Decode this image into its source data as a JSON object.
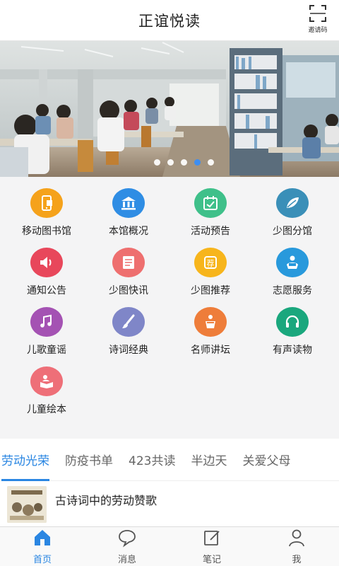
{
  "header": {
    "title": "正谊悦读",
    "scan_label": "邀请码"
  },
  "banner": {
    "slide_count": 5,
    "active_index": 3
  },
  "grid": {
    "items": [
      {
        "label": "移动图书馆",
        "icon": "phone-book-icon",
        "color": "#f5a21b"
      },
      {
        "label": "本馆概况",
        "icon": "library-building-icon",
        "color": "#2f8de4"
      },
      {
        "label": "活动预告",
        "icon": "calendar-icon",
        "color": "#3fc08a"
      },
      {
        "label": "少图分馆",
        "icon": "branch-leaf-icon",
        "color": "#3a8fb8"
      },
      {
        "label": "通知公告",
        "icon": "speaker-icon",
        "color": "#e8475b"
      },
      {
        "label": "少图快讯",
        "icon": "news-icon",
        "color": "#ee6f6f"
      },
      {
        "label": "少图推荐",
        "icon": "recommend-icon",
        "color": "#f7b51c"
      },
      {
        "label": "志愿服务",
        "icon": "volunteer-icon",
        "color": "#2899dc"
      },
      {
        "label": "儿歌童谣",
        "icon": "music-notes-icon",
        "color": "#a452b3"
      },
      {
        "label": "诗词经典",
        "icon": "brush-icon",
        "color": "#7f86c8"
      },
      {
        "label": "名师讲坛",
        "icon": "lectern-icon",
        "color": "#ee7d3a"
      },
      {
        "label": "有声读物",
        "icon": "headphones-icon",
        "color": "#1aa77d"
      },
      {
        "label": "儿童绘本",
        "icon": "picture-book-icon",
        "color": "#ee6f78"
      }
    ]
  },
  "tabs": [
    {
      "label": "劳动光荣",
      "active": true
    },
    {
      "label": "防疫书单",
      "active": false
    },
    {
      "label": "423共读",
      "active": false
    },
    {
      "label": "半边天",
      "active": false
    },
    {
      "label": "关爱父母",
      "active": false
    }
  ],
  "article": {
    "title": "古诗词中的劳动赞歌"
  },
  "bottom_nav": [
    {
      "label": "首页",
      "icon": "home-icon",
      "active": true
    },
    {
      "label": "消息",
      "icon": "message-icon",
      "active": false
    },
    {
      "label": "笔记",
      "icon": "note-icon",
      "active": false
    },
    {
      "label": "我",
      "icon": "user-icon",
      "active": false
    }
  ],
  "colors": {
    "accent": "#2a86e2",
    "grid_bg": "#f4f4f5"
  }
}
